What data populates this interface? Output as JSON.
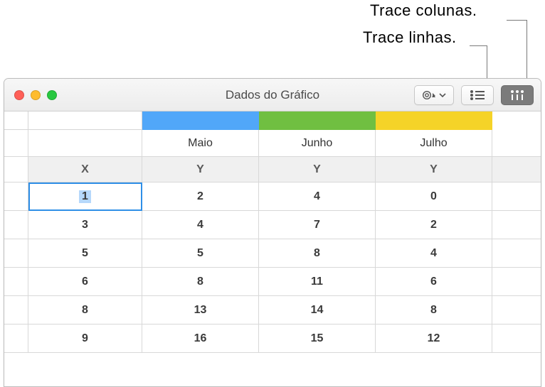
{
  "callouts": {
    "columns": "Trace colunas.",
    "rows": "Trace linhas."
  },
  "window": {
    "title": "Dados do Gráfico"
  },
  "toolbar": {
    "settings_name": "settings-menu",
    "rows_mode_name": "plot-rows-button",
    "cols_mode_name": "plot-columns-button"
  },
  "columns": [
    {
      "label": "Maio",
      "axis": "Y",
      "color": "#51a7f9"
    },
    {
      "label": "Junho",
      "axis": "Y",
      "color": "#70bf41"
    },
    {
      "label": "Julho",
      "axis": "Y",
      "color": "#f5d328"
    }
  ],
  "x_axis_label": "X",
  "rows": [
    {
      "x": "1",
      "y": [
        "2",
        "4",
        "0"
      ],
      "selected": true
    },
    {
      "x": "3",
      "y": [
        "4",
        "7",
        "2"
      ]
    },
    {
      "x": "5",
      "y": [
        "5",
        "8",
        "4"
      ]
    },
    {
      "x": "6",
      "y": [
        "8",
        "11",
        "6"
      ]
    },
    {
      "x": "8",
      "y": [
        "13",
        "14",
        "8"
      ]
    },
    {
      "x": "9",
      "y": [
        "16",
        "15",
        "12"
      ]
    }
  ],
  "chart_data": {
    "type": "table",
    "x_label": "X",
    "series": [
      {
        "name": "Maio",
        "color": "#51a7f9",
        "values": [
          2,
          4,
          5,
          8,
          13,
          16
        ]
      },
      {
        "name": "Junho",
        "color": "#70bf41",
        "values": [
          4,
          7,
          8,
          11,
          14,
          15
        ]
      },
      {
        "name": "Julho",
        "color": "#f5d328",
        "values": [
          0,
          2,
          4,
          6,
          8,
          12
        ]
      }
    ],
    "x": [
      1,
      3,
      5,
      6,
      8,
      9
    ]
  }
}
